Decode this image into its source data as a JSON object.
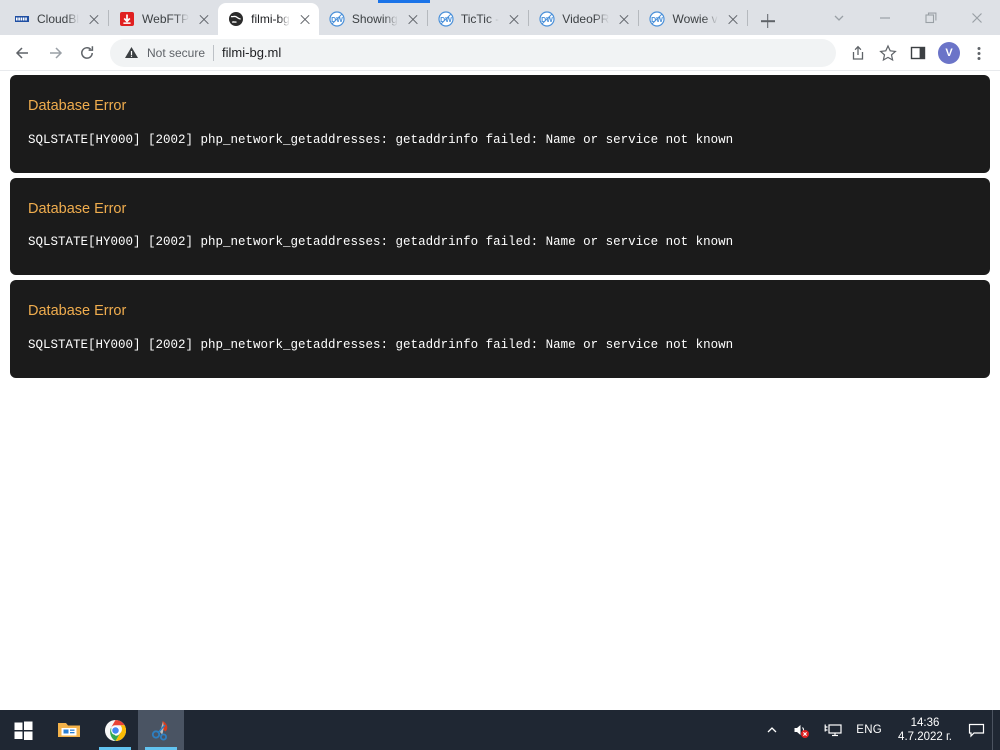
{
  "browser": {
    "tabs": [
      {
        "title": "CloudBl",
        "favicon": "cloudblue-icon",
        "active": false
      },
      {
        "title": "WebFTP",
        "favicon": "webftp-download-icon",
        "active": false
      },
      {
        "title": "filmi-bg",
        "favicon": "globe-icon",
        "active": true
      },
      {
        "title": "Showing",
        "favicon": "dw-icon",
        "active": false
      },
      {
        "title": "TicTic -",
        "favicon": "dw-icon",
        "active": false
      },
      {
        "title": "VideoPR",
        "favicon": "dw-icon",
        "active": false
      },
      {
        "title": "Wowie v",
        "favicon": "dw-icon",
        "active": false
      }
    ],
    "new_tab_label": "+",
    "window_controls": {
      "tab_search": "tab-search-chevron",
      "minimize": "minimize",
      "maximize": "maximize",
      "close": "close"
    },
    "toolbar": {
      "back": "back-arrow",
      "forward": "forward-arrow",
      "reload": "reload",
      "security_label": "Not secure",
      "url": "filmi-bg.ml",
      "share": "share-icon",
      "bookmark": "star-icon",
      "side_panel": "side-panel-icon",
      "profile_initial": "V",
      "profile_color": "#6b74c8",
      "menu": "three-dot-menu"
    }
  },
  "page": {
    "accent_color": "#f0ad4e",
    "panel_color": "#1b1b1b",
    "errors": [
      {
        "title": "Database Error",
        "message": "SQLSTATE[HY000] [2002] php_network_getaddresses: getaddrinfo failed: Name or service not known"
      },
      {
        "title": "Database Error",
        "message": "SQLSTATE[HY000] [2002] php_network_getaddresses: getaddrinfo failed: Name or service not known"
      },
      {
        "title": "Database Error",
        "message": "SQLSTATE[HY000] [2002] php_network_getaddresses: getaddrinfo failed: Name or service not known"
      }
    ]
  },
  "taskbar": {
    "apps": [
      {
        "name": "start-button",
        "icon": "windows-logo"
      },
      {
        "name": "file-explorer",
        "icon": "folder-icon",
        "running": true
      },
      {
        "name": "google-chrome",
        "icon": "chrome-icon",
        "running": true
      },
      {
        "name": "snipping-tool",
        "icon": "snip-sketch-icon",
        "running": true,
        "active": true
      }
    ],
    "tray": {
      "overflow": "chevron-up-icon",
      "volume": "volume-muted-icon",
      "network": "network-icon",
      "language": "ENG",
      "time": "14:36",
      "date": "4.7.2022 г.",
      "notifications": "notification-icon"
    }
  }
}
